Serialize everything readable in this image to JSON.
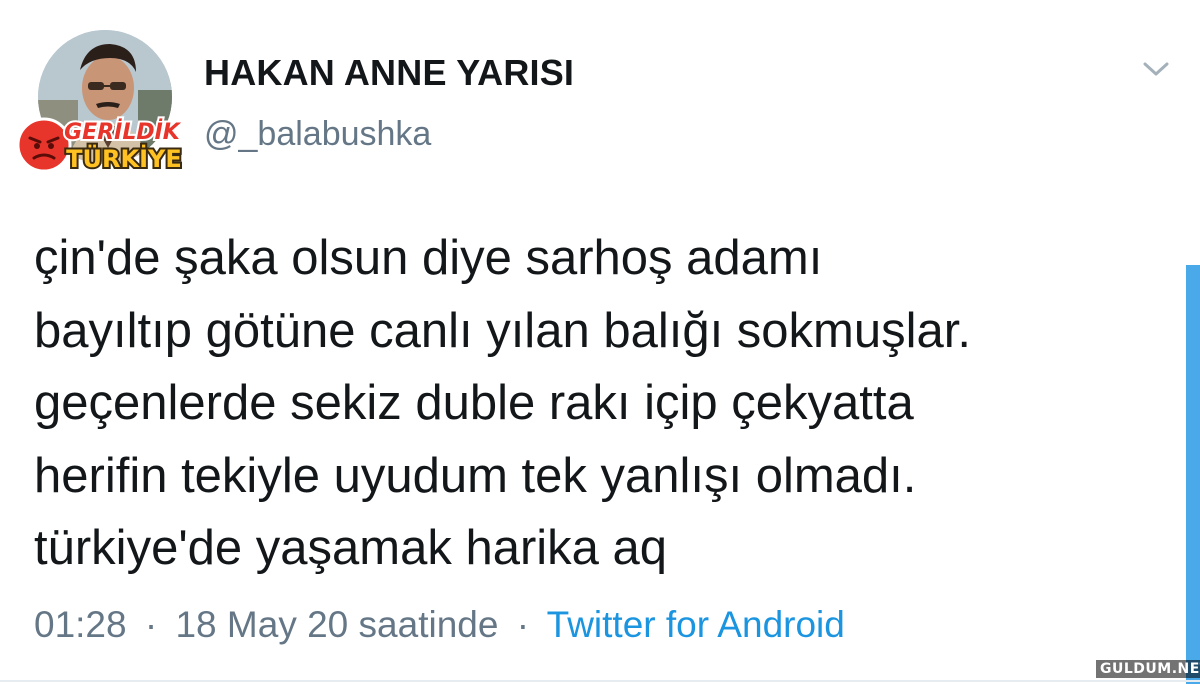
{
  "tweet": {
    "author": {
      "display_name": "HAKAN ANNE YARISI",
      "handle": "@_balabushka"
    },
    "menu_icon": "chevron-down-icon",
    "text_lines": [
      "çin'de şaka olsun diye sarhoş adamı",
      "bayıltıp götüne canlı yılan balığı sokmuşlar.",
      "geçenlerde sekiz duble rakı içip çekyatta",
      "herifin tekiyle uyudum tek yanlışı olmadı.",
      "türkiye'de yaşamak harika aq"
    ],
    "time": "01:28",
    "separator": "·",
    "date": "18 May 20 saatinde",
    "source": "Twitter for Android"
  },
  "overlay_logo": {
    "line1": "GERİLDİK",
    "line2": "TÜRKİYE",
    "colors": {
      "red": "#e8352b",
      "yellow": "#ffc222"
    }
  },
  "site_watermark": "GULDUM.NET",
  "colors": {
    "text": "#14171a",
    "muted": "#657786",
    "link": "#1b95e0",
    "scroll_bar": "#4aa9e8"
  }
}
